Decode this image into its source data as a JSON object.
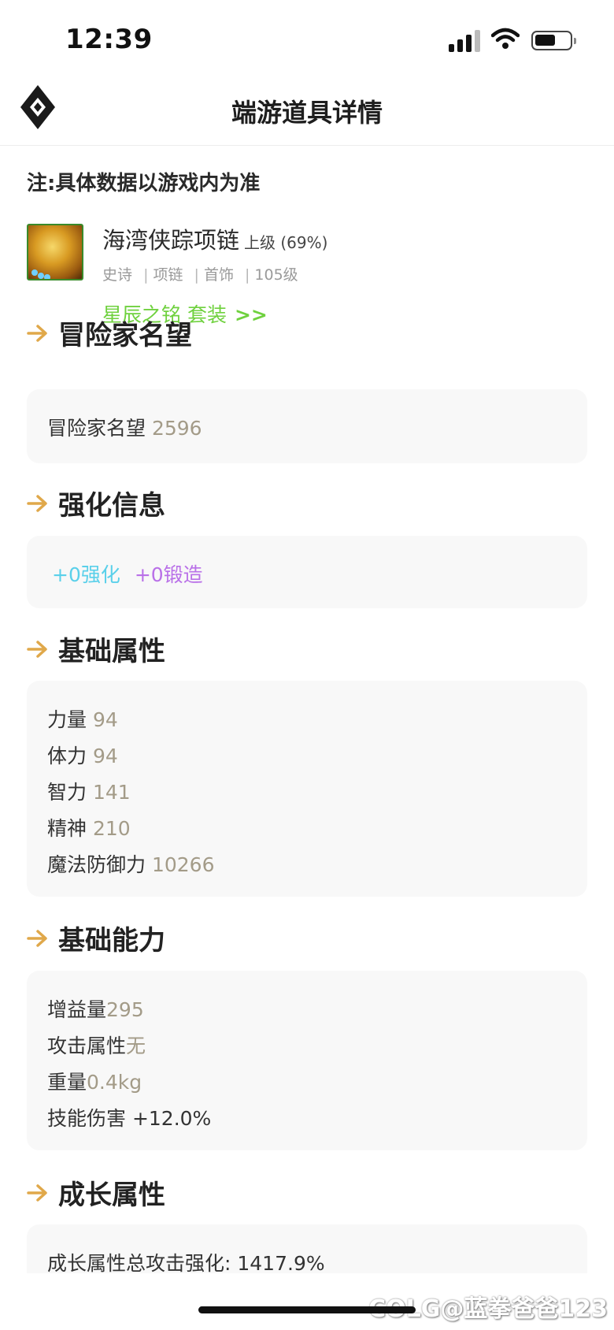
{
  "status_bar": {
    "time": "12:39"
  },
  "header": {
    "title": "端游道具详情"
  },
  "note": "注:具体数据以游戏内为准",
  "item": {
    "name": "海湾侠踪项链",
    "grade": "上级 (69%)",
    "rarity": "史诗",
    "type": "项链",
    "slot": "首饰",
    "level": "105级",
    "set_name": "星辰之铭 套装",
    "set_arrows": ">>"
  },
  "sections": {
    "reputation": {
      "title": "冒险家名望",
      "label": "冒险家名望",
      "value": "2596"
    },
    "enhance": {
      "title": "强化信息",
      "reinforce": "+0强化",
      "forge": "+0锻造"
    },
    "base_attrs": {
      "title": "基础属性",
      "rows": [
        {
          "label": "力量",
          "value": "94"
        },
        {
          "label": "体力",
          "value": "94"
        },
        {
          "label": "智力",
          "value": "141"
        },
        {
          "label": "精神",
          "value": "210"
        },
        {
          "label": "魔法防御力",
          "value": "10266"
        }
      ]
    },
    "base_ability": {
      "title": "基础能力",
      "rows": [
        {
          "label": "增益量",
          "value": "295"
        },
        {
          "label": "攻击属性",
          "value": "无"
        },
        {
          "label": "重量",
          "value": "0.4kg"
        },
        {
          "label": "技能伤害 +12.0%",
          "value": ""
        }
      ]
    },
    "growth": {
      "title": "成长属性",
      "rows": [
        {
          "label": "成长属性总攻击强化: 1417.9%"
        }
      ]
    }
  },
  "watermark": "COLG@蓝拳爸爸123",
  "colors": {
    "accent_gold": "#e0a84a",
    "set_green": "#6fd13e",
    "enhance_cyan": "#5ad0ea",
    "forge_purple": "#b970e8",
    "value_taupe": "#a39b88"
  },
  "icons": [
    "signal-icon",
    "wifi-icon",
    "battery-icon",
    "app-logo-icon",
    "section-arrow-icon"
  ]
}
